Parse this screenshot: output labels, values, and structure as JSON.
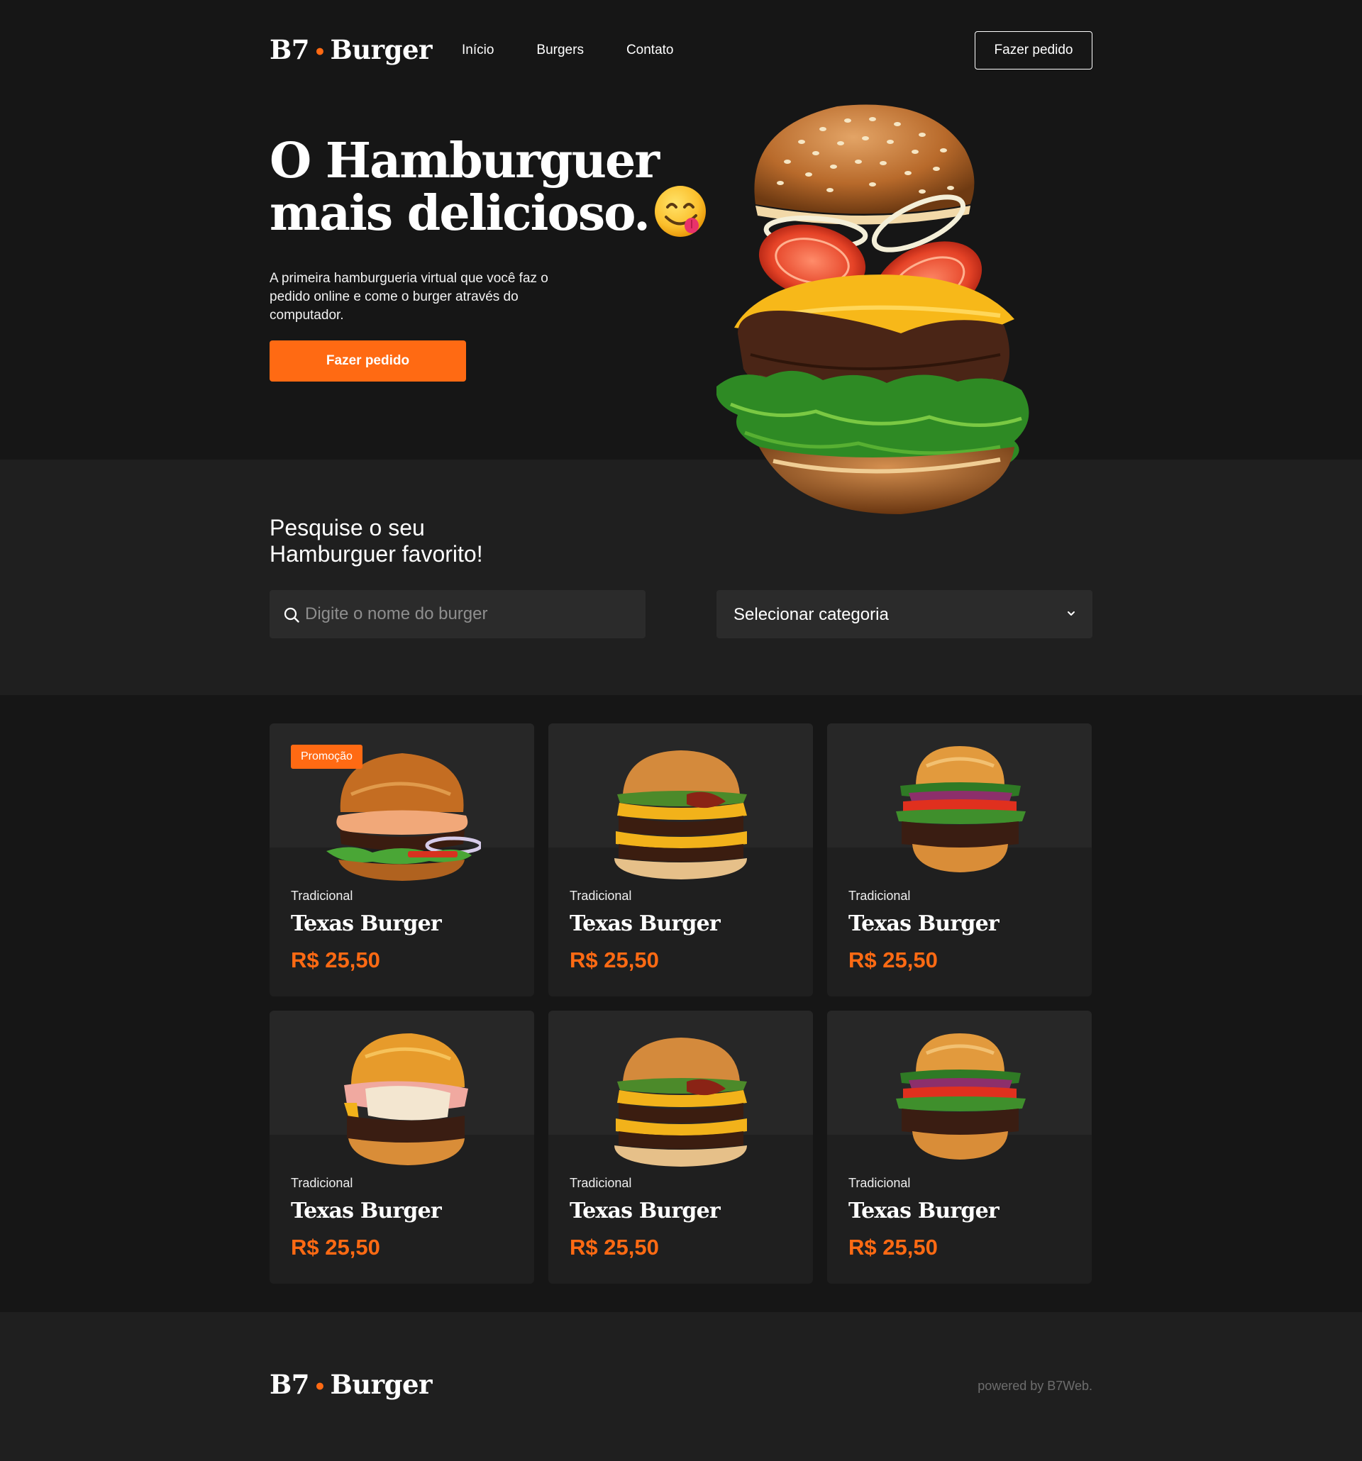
{
  "brand": {
    "name_left": "B7",
    "separator": "•",
    "name_right": "Burger"
  },
  "nav": {
    "items": [
      "Início",
      "Burgers",
      "Contato"
    ],
    "order_button": "Fazer pedido"
  },
  "hero": {
    "title_line1": "O Hamburguer",
    "title_line2": "mais delicioso.",
    "description": "A primeira hamburgueria virtual que você faz o pedido online e come o burger através do computador.",
    "cta": "Fazer pedido"
  },
  "search": {
    "title_line1": "Pesquise o seu",
    "title_line2": "Hamburguer favorito!",
    "placeholder": "Digite o nome do burger",
    "category_select": "Selecionar categoria"
  },
  "products": [
    {
      "badge": "Promoção",
      "category": "Tradicional",
      "name": "Texas Burger",
      "price": "R$ 25,50"
    },
    {
      "badge": "",
      "category": "Tradicional",
      "name": "Texas Burger",
      "price": "R$ 25,50"
    },
    {
      "badge": "",
      "category": "Tradicional",
      "name": "Texas Burger",
      "price": "R$ 25,50"
    },
    {
      "badge": "",
      "category": "Tradicional",
      "name": "Texas Burger",
      "price": "R$ 25,50"
    },
    {
      "badge": "",
      "category": "Tradicional",
      "name": "Texas Burger",
      "price": "R$ 25,50"
    },
    {
      "badge": "",
      "category": "Tradicional",
      "name": "Texas Burger",
      "price": "R$ 25,50"
    }
  ],
  "footer": {
    "powered_by": "powered by B7Web."
  },
  "colors": {
    "accent": "#ff6a13",
    "background": "#161616",
    "surface": "#1f1f1f",
    "card_image_bg": "#272727"
  }
}
